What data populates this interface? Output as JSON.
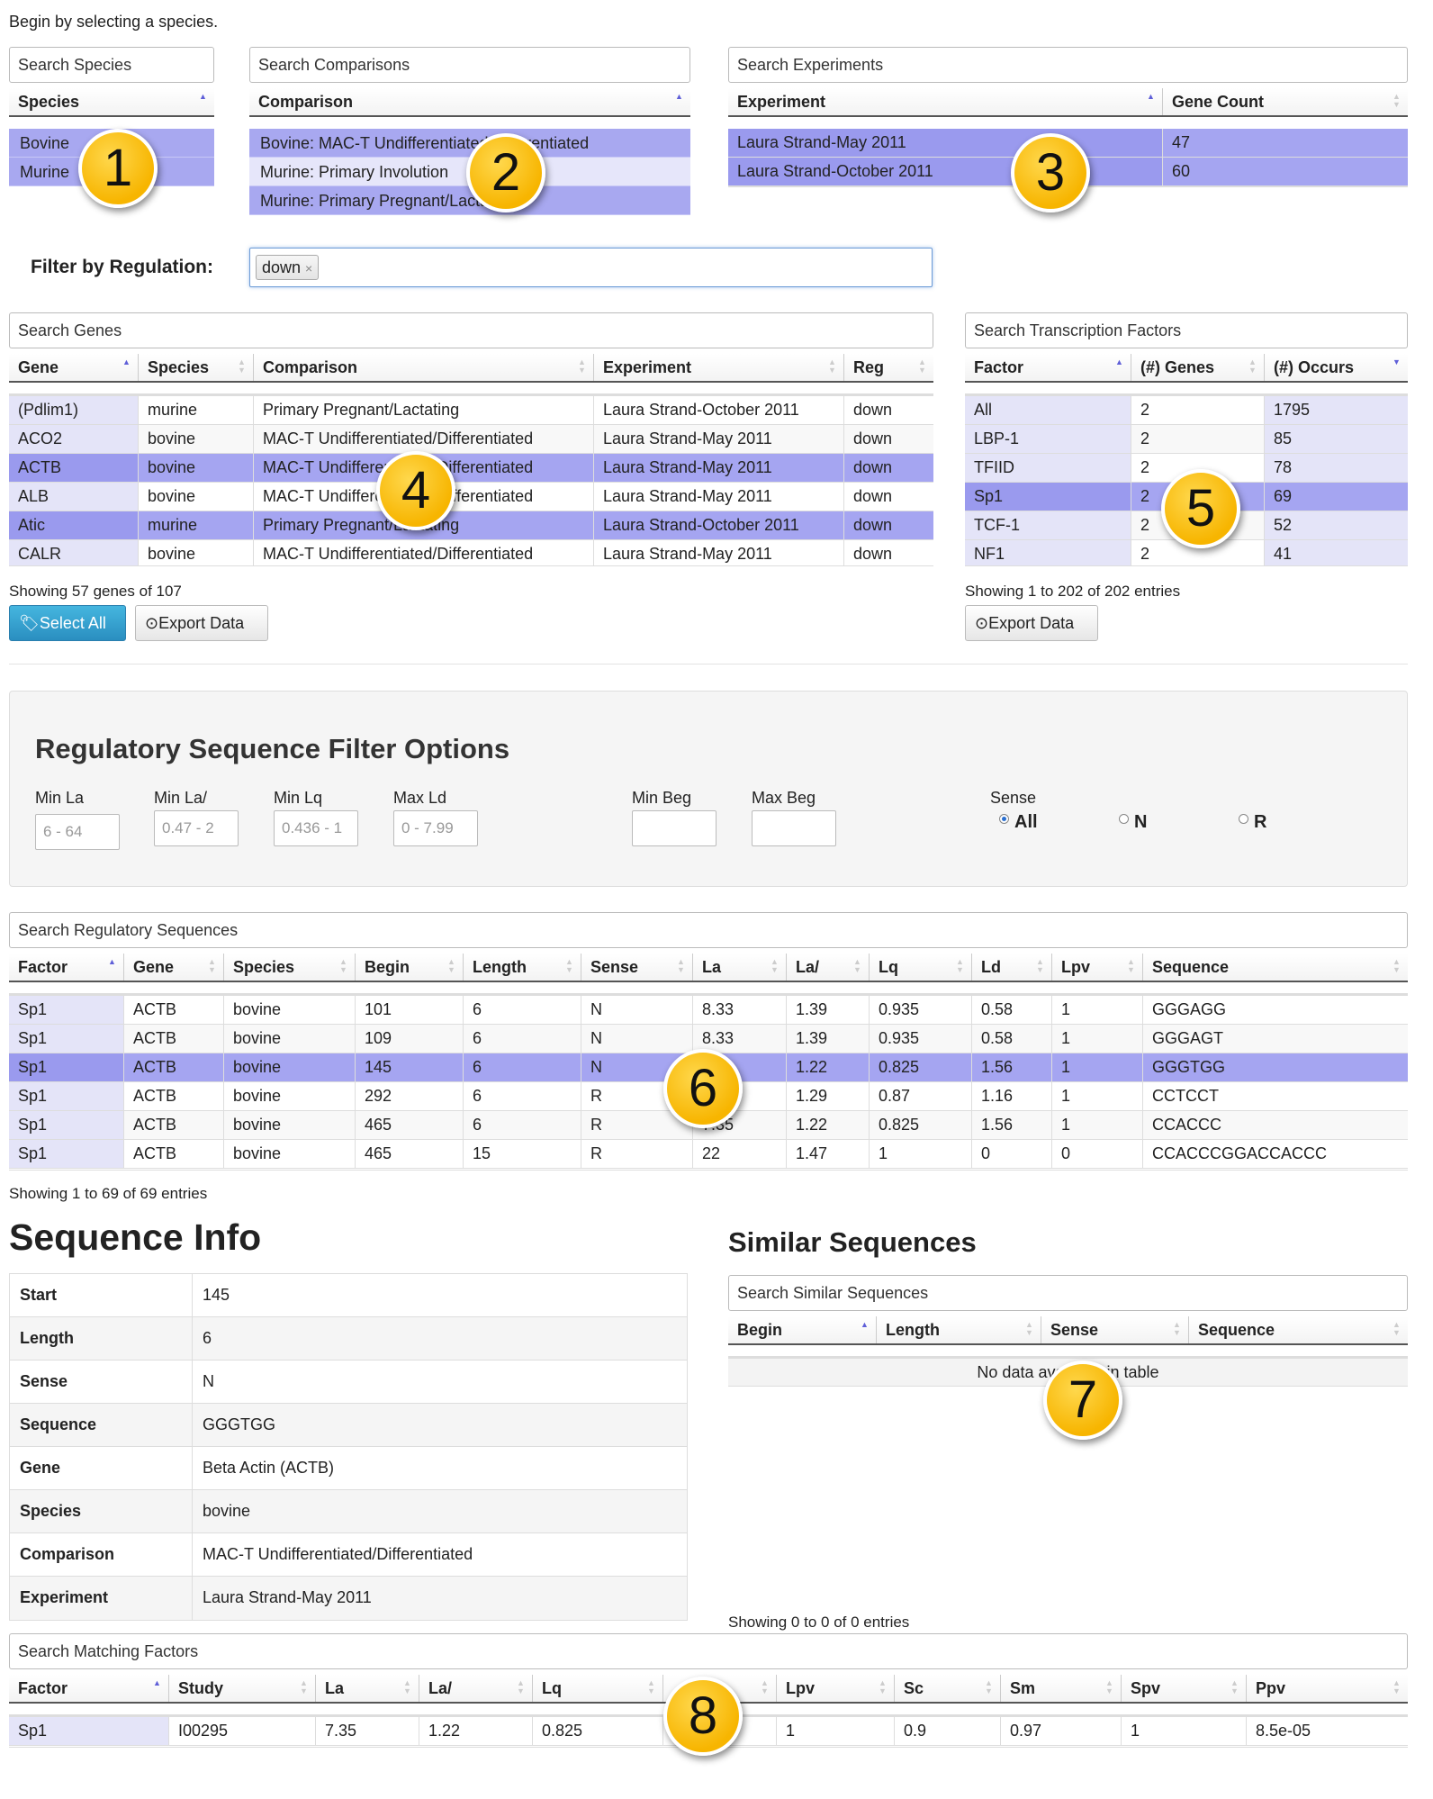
{
  "intro": "Begin by selecting a species.",
  "species": {
    "search": "Search Species",
    "header": "Species",
    "items": [
      "Bovine",
      "Murine"
    ]
  },
  "comparisons": {
    "search": "Search Comparisons",
    "header": "Comparison",
    "items": [
      "Bovine: MAC-T Undifferentiated/Differentiated",
      "Murine: Primary Involution",
      "Murine: Primary Pregnant/Lactating"
    ]
  },
  "experiments": {
    "search": "Search Experiments",
    "headers": [
      "Experiment",
      "Gene Count"
    ],
    "rows": [
      [
        "Laura Strand-May 2011",
        "47"
      ],
      [
        "Laura Strand-October 2011",
        "60"
      ]
    ]
  },
  "regulation": {
    "label": "Filter by Regulation:",
    "tag": "down",
    "tag_remove": "×"
  },
  "genes": {
    "search": "Search Genes",
    "headers": [
      "Gene",
      "Species",
      "Comparison",
      "Experiment",
      "Reg"
    ],
    "rows": [
      [
        "(Pdlim1)",
        "murine",
        "Primary Pregnant/Lactating",
        "Laura Strand-October 2011",
        "down"
      ],
      [
        "ACO2",
        "bovine",
        "MAC-T Undifferentiated/Differentiated",
        "Laura Strand-May 2011",
        "down"
      ],
      [
        "ACTB",
        "bovine",
        "MAC-T Undifferentiated/Differentiated",
        "Laura Strand-May 2011",
        "down"
      ],
      [
        "ALB",
        "bovine",
        "MAC-T Undifferentiated/Differentiated",
        "Laura Strand-May 2011",
        "down"
      ],
      [
        "Atic",
        "murine",
        "Primary Pregnant/Lactating",
        "Laura Strand-October 2011",
        "down"
      ],
      [
        "CALR",
        "bovine",
        "MAC-T Undifferentiated/Differentiated",
        "Laura Strand-May 2011",
        "down"
      ]
    ],
    "info": "Showing 57 genes of 107",
    "select_all": "Select All",
    "export": "Export Data"
  },
  "factors": {
    "search": "Search Transcription Factors",
    "headers": [
      "Factor",
      "(#) Genes",
      "(#) Occurs"
    ],
    "rows": [
      [
        "All",
        "2",
        "1795"
      ],
      [
        "LBP-1",
        "2",
        "85"
      ],
      [
        "TFIID",
        "2",
        "78"
      ],
      [
        "Sp1",
        "2",
        "69"
      ],
      [
        "TCF-1",
        "2",
        "52"
      ],
      [
        "NF1",
        "2",
        "41"
      ]
    ],
    "info": "Showing 1 to 202 of 202 entries",
    "export": "Export Data"
  },
  "filter_options": {
    "title": "Regulatory Sequence Filter Options",
    "fields": [
      {
        "label": "Min La",
        "placeholder": "6 - 64"
      },
      {
        "label": "Min La/",
        "placeholder": "0.47 - 2"
      },
      {
        "label": "Min Lq",
        "placeholder": "0.436 - 1"
      },
      {
        "label": "Max Ld",
        "placeholder": "0 - 7.99"
      },
      {
        "label": "Min Beg",
        "placeholder": ""
      },
      {
        "label": "Max Beg",
        "placeholder": ""
      }
    ],
    "sense_label": "Sense",
    "sense_options": [
      "All",
      "N",
      "R"
    ],
    "sense_selected": "All"
  },
  "reg_sequences": {
    "search": "Search Regulatory Sequences",
    "headers": [
      "Factor",
      "Gene",
      "Species",
      "Begin",
      "Length",
      "Sense",
      "La",
      "La/",
      "Lq",
      "Ld",
      "Lpv",
      "Sequence"
    ],
    "rows": [
      [
        "Sp1",
        "ACTB",
        "bovine",
        "101",
        "6",
        "N",
        "8.33",
        "1.39",
        "0.935",
        "0.58",
        "1",
        "GGGAGG"
      ],
      [
        "Sp1",
        "ACTB",
        "bovine",
        "109",
        "6",
        "N",
        "8.33",
        "1.39",
        "0.935",
        "0.58",
        "1",
        "GGGAGT"
      ],
      [
        "Sp1",
        "ACTB",
        "bovine",
        "145",
        "6",
        "N",
        "",
        "1.22",
        "0.825",
        "1.56",
        "1",
        "GGGTGG"
      ],
      [
        "Sp1",
        "ACTB",
        "bovine",
        "292",
        "6",
        "R",
        "",
        "1.29",
        "0.87",
        "1.16",
        "1",
        "CCTCCT"
      ],
      [
        "Sp1",
        "ACTB",
        "bovine",
        "465",
        "6",
        "R",
        "7.35",
        "1.22",
        "0.825",
        "1.56",
        "1",
        "CCACCC"
      ],
      [
        "Sp1",
        "ACTB",
        "bovine",
        "465",
        "15",
        "R",
        "22",
        "1.47",
        "1",
        "0",
        "0",
        "CCACCCGGACCACCC"
      ]
    ],
    "info": "Showing 1 to 69 of 69 entries"
  },
  "sequence_info": {
    "title": "Sequence Info",
    "rows": [
      [
        "Start",
        "145"
      ],
      [
        "Length",
        "6"
      ],
      [
        "Sense",
        "N"
      ],
      [
        "Sequence",
        "GGGTGG"
      ],
      [
        "Gene",
        "Beta Actin (ACTB)"
      ],
      [
        "Species",
        "bovine"
      ],
      [
        "Comparison",
        "MAC-T Undifferentiated/Differentiated"
      ],
      [
        "Experiment",
        "Laura Strand-May 2011"
      ]
    ]
  },
  "similar": {
    "title": "Similar Sequences",
    "search": "Search Similar Sequences",
    "headers": [
      "Begin",
      "Length",
      "Sense",
      "Sequence"
    ],
    "empty": "No data available in table",
    "info": "Showing 0 to 0 of 0 entries"
  },
  "matching": {
    "search": "Search Matching Factors",
    "headers": [
      "Factor",
      "Study",
      "La",
      "La/",
      "Lq",
      "",
      "Lpv",
      "Sc",
      "Sm",
      "Spv",
      "Ppv"
    ],
    "rows": [
      [
        "Sp1",
        "I00295",
        "7.35",
        "1.22",
        "0.825",
        "",
        "1",
        "0.9",
        "0.97",
        "1",
        "8.5e-05"
      ]
    ]
  },
  "badges": [
    "1",
    "2",
    "3",
    "4",
    "5",
    "6",
    "7",
    "8"
  ]
}
